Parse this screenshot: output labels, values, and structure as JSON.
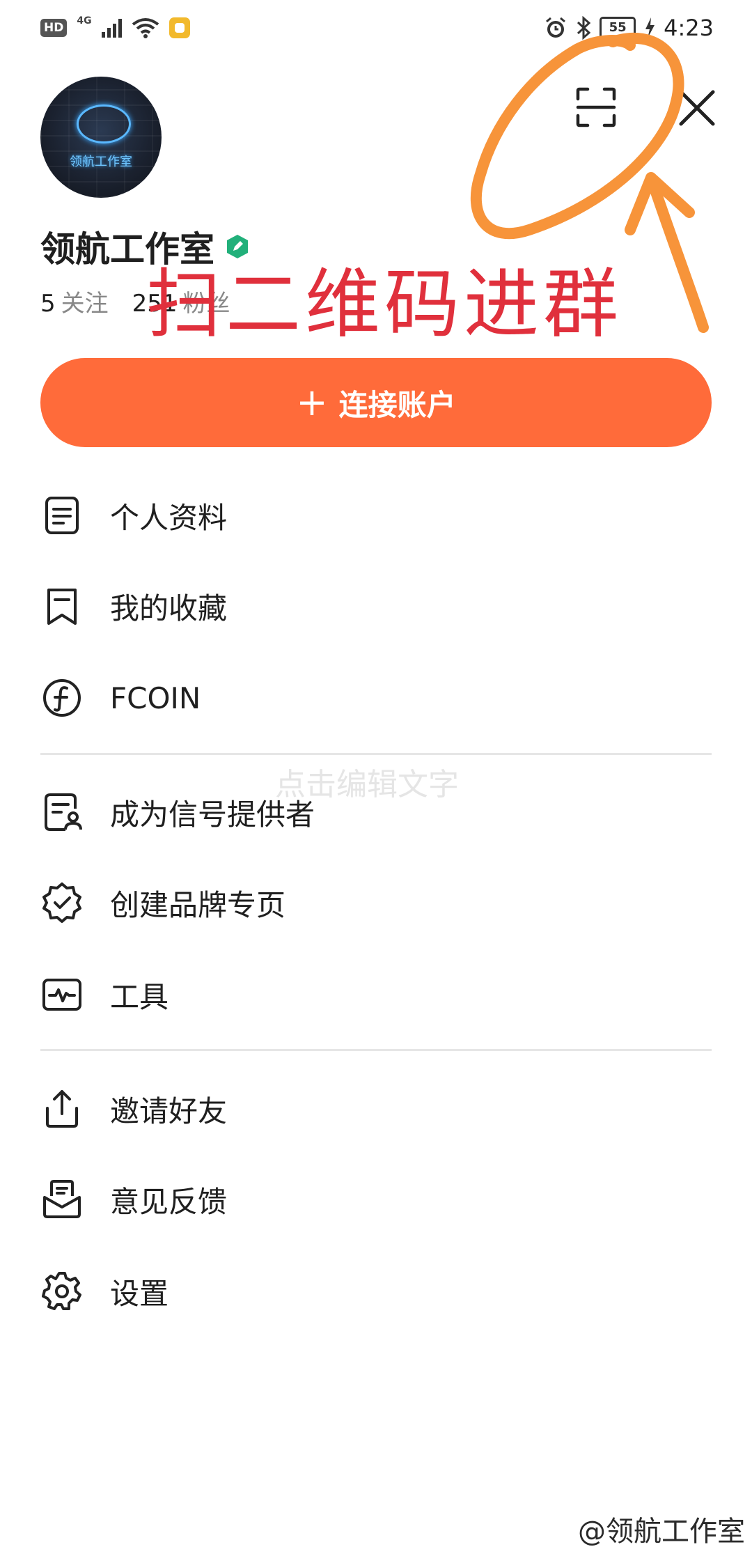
{
  "status_bar": {
    "hd": "HD",
    "network": "4G",
    "battery": "55",
    "time": "4:23"
  },
  "profile": {
    "avatar_text": "领航工作室",
    "name": "领航工作室",
    "following_count": "5",
    "following_label": "关注",
    "followers_count": "251",
    "followers_label": "粉丝"
  },
  "annotation": {
    "text": "扫二维码进群",
    "color": "#e0303c"
  },
  "connect_button": {
    "plus": "+",
    "label": "连接账户",
    "color": "#ff6b3a"
  },
  "menu": [
    {
      "label": "个人资料",
      "icon": "document-icon"
    },
    {
      "label": "我的收藏",
      "icon": "bookmark-icon"
    },
    {
      "label": "FCOIN",
      "icon": "fcoin-icon"
    },
    {
      "label": "成为信号提供者",
      "icon": "signal-provider-icon"
    },
    {
      "label": "创建品牌专页",
      "icon": "badge-check-icon"
    },
    {
      "label": "工具",
      "icon": "activity-chart-icon"
    },
    {
      "label": "邀请好友",
      "icon": "share-icon"
    },
    {
      "label": "意见反馈",
      "icon": "feedback-icon"
    },
    {
      "label": "设置",
      "icon": "settings-icon"
    }
  ],
  "watermarks": {
    "center": "点击编辑文字",
    "corner": "@领航工作室"
  }
}
